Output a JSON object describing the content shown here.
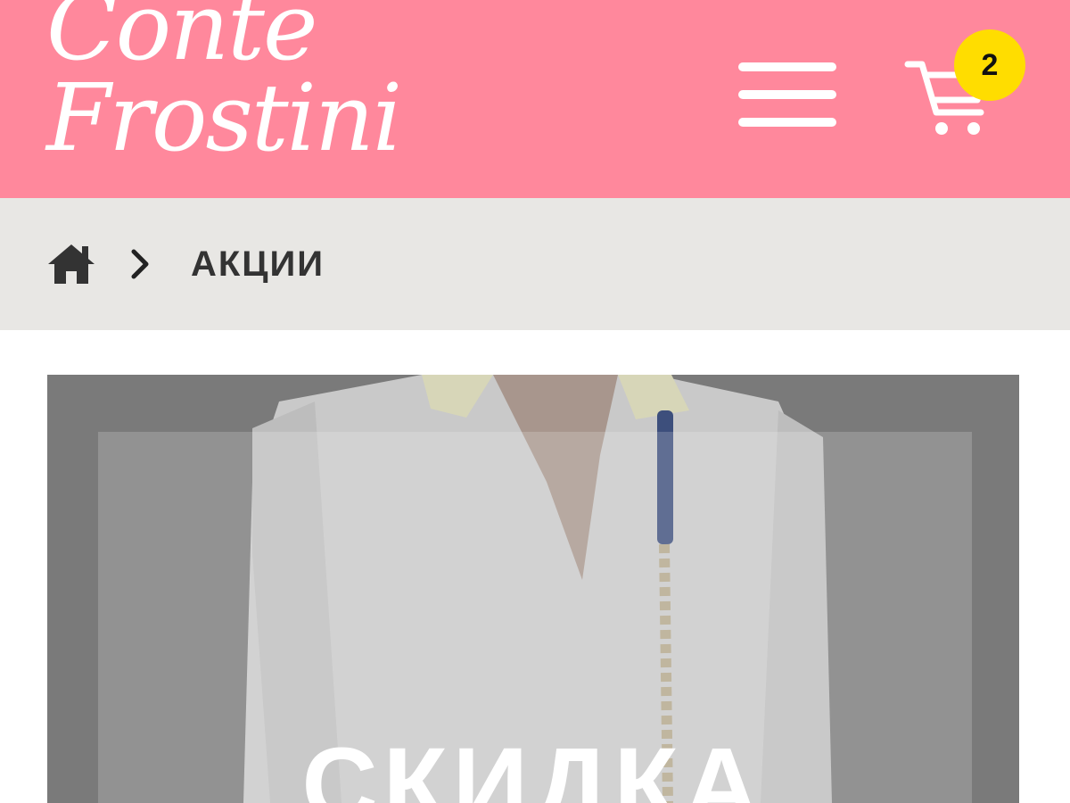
{
  "header": {
    "logo_line1": "Conte",
    "logo_line2": "Frostini",
    "background_color": "#ff889c",
    "menu_icon": "hamburger-menu-icon",
    "cart_icon": "shopping-cart-icon",
    "cart_count": "2",
    "badge_color": "#ffdd00"
  },
  "breadcrumb": {
    "home_icon": "home-icon",
    "separator_icon": "chevron-right-icon",
    "current": "АКЦИИ",
    "background_color": "#e8e7e4"
  },
  "promo": {
    "title": "СКИДКА"
  }
}
